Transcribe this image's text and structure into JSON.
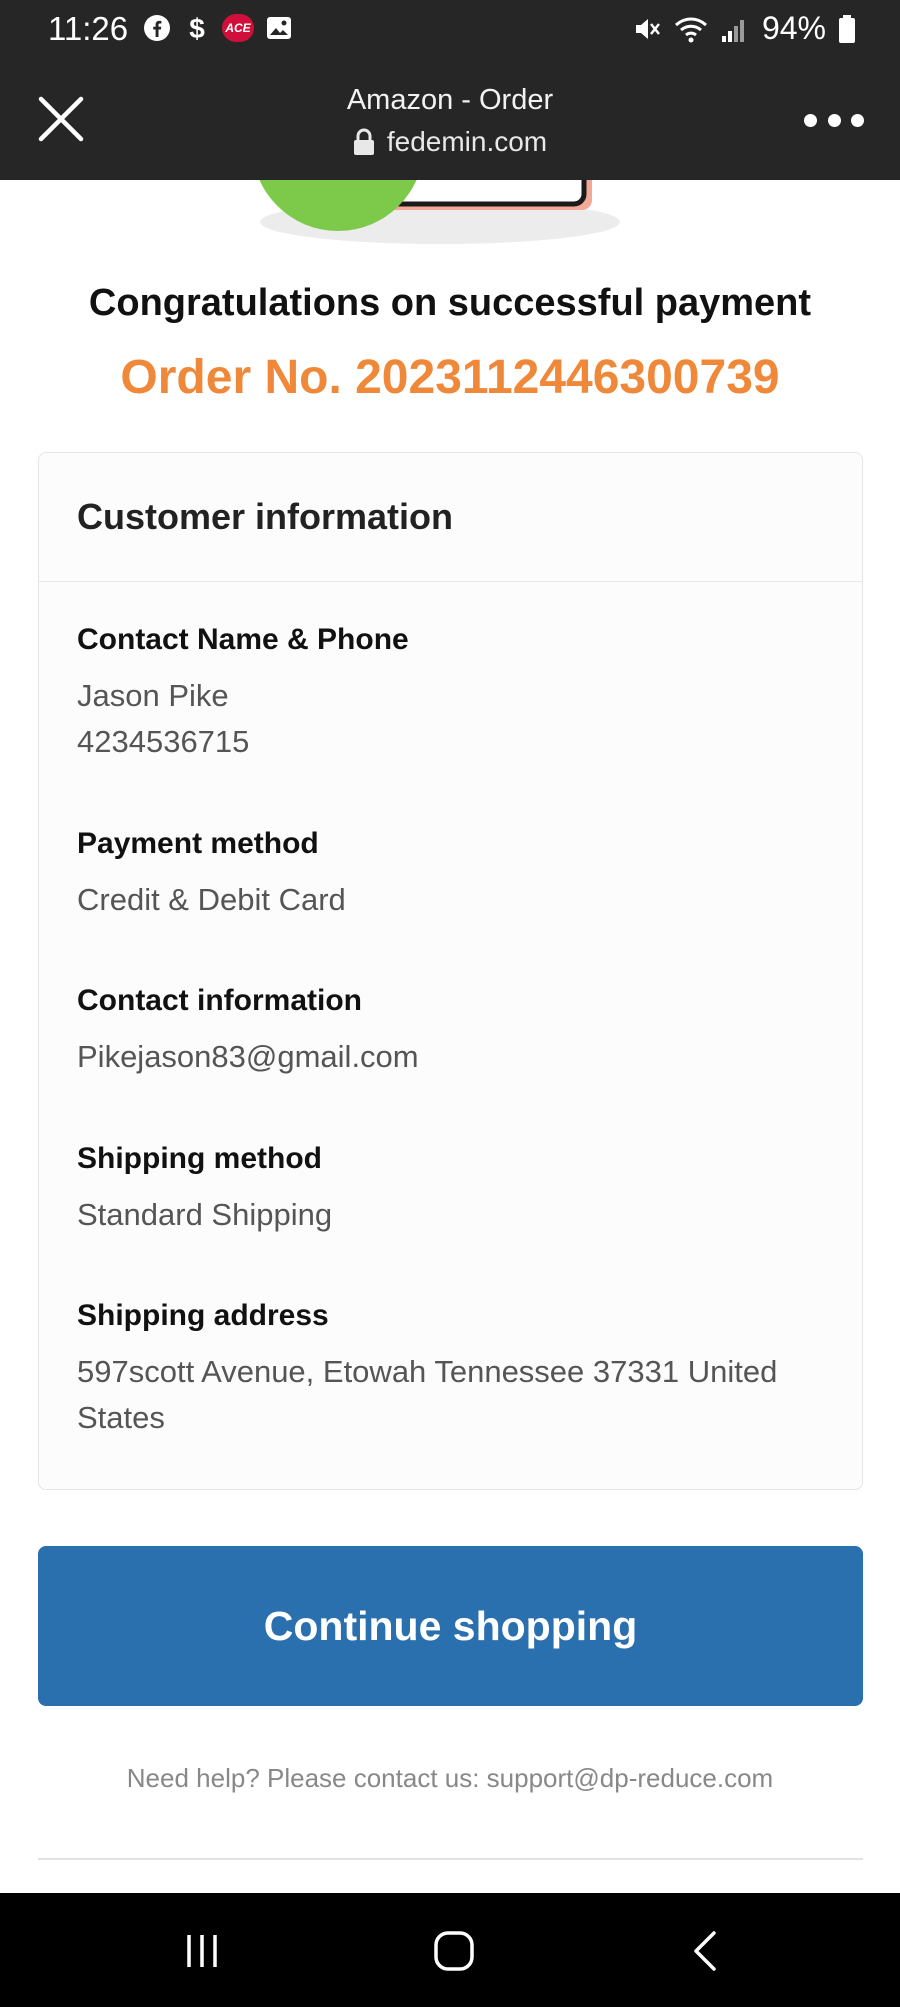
{
  "status_bar": {
    "time": "11:26",
    "left_icons": [
      "facebook-icon",
      "dollar-icon",
      "ace-app-icon",
      "gallery-icon"
    ],
    "ace_label": "ACE",
    "right_icons": [
      "mute-icon",
      "wifi-icon",
      "signal-icon",
      "battery-icon"
    ],
    "battery": "94%"
  },
  "browser": {
    "title": "Amazon - Order",
    "url": "fedemin.com"
  },
  "page": {
    "congrats": "Congratulations on successful payment",
    "order_no": "Order No. 2023112446300739",
    "card_title": "Customer information",
    "fields": [
      {
        "label": "Contact Name & Phone",
        "value_lines": [
          "Jason Pike",
          "4234536715"
        ]
      },
      {
        "label": "Payment method",
        "value_lines": [
          "Credit & Debit Card"
        ]
      },
      {
        "label": "Contact information",
        "value_lines": [
          "Pikejason83@gmail.com"
        ]
      },
      {
        "label": "Shipping method",
        "value_lines": [
          "Standard Shipping"
        ]
      },
      {
        "label": "Shipping address",
        "value_lines": [
          "597scott Avenue, Etowah Tennessee 37331 United States"
        ]
      }
    ],
    "continue_label": "Continue shopping",
    "help_text": "Need help? Please contact us: support@dp-reduce.com"
  },
  "colors": {
    "accent_orange": "#f0883a",
    "button_blue": "#2a6fae",
    "chrome_dark": "#262626"
  }
}
